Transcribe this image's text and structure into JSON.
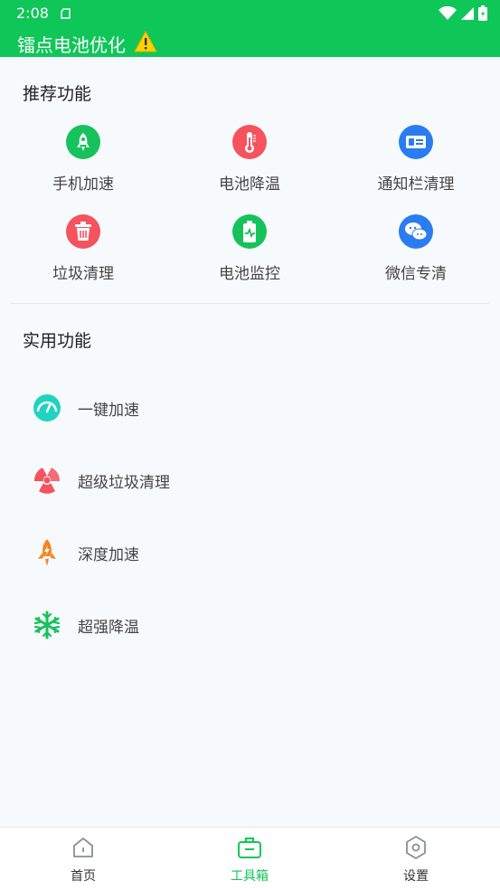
{
  "status_bar": {
    "time": "2:08"
  },
  "app": {
    "title": "镭点电池优化"
  },
  "recommended": {
    "title": "推荐功能",
    "items": [
      {
        "label": "手机加速",
        "icon": "rocket-icon",
        "color": "#16c25c"
      },
      {
        "label": "电池降温",
        "icon": "thermometer-icon",
        "color": "#f5535e"
      },
      {
        "label": "通知栏清理",
        "icon": "notification-card-icon",
        "color": "#2b7cf0"
      },
      {
        "label": "垃圾清理",
        "icon": "trash-icon",
        "color": "#f5535e"
      },
      {
        "label": "电池监控",
        "icon": "battery-monitor-icon",
        "color": "#16c25c"
      },
      {
        "label": "微信专清",
        "icon": "wechat-icon",
        "color": "#2b7cf0"
      }
    ]
  },
  "utility": {
    "title": "实用功能",
    "items": [
      {
        "label": "一键加速",
        "icon": "speedometer-icon",
        "color": "#1fd3c0"
      },
      {
        "label": "超级垃圾清理",
        "icon": "radiation-icon",
        "color": "#f5535e"
      },
      {
        "label": "深度加速",
        "icon": "flame-rocket-icon",
        "color": "#f5841f"
      },
      {
        "label": "超强降温",
        "icon": "snowflake-icon",
        "color": "#16c25c"
      }
    ]
  },
  "tabs": [
    {
      "label": "首页",
      "icon": "home-icon",
      "active": false
    },
    {
      "label": "工具箱",
      "icon": "toolbox-icon",
      "active": true
    },
    {
      "label": "设置",
      "icon": "settings-hexagon-icon",
      "active": false
    }
  ]
}
